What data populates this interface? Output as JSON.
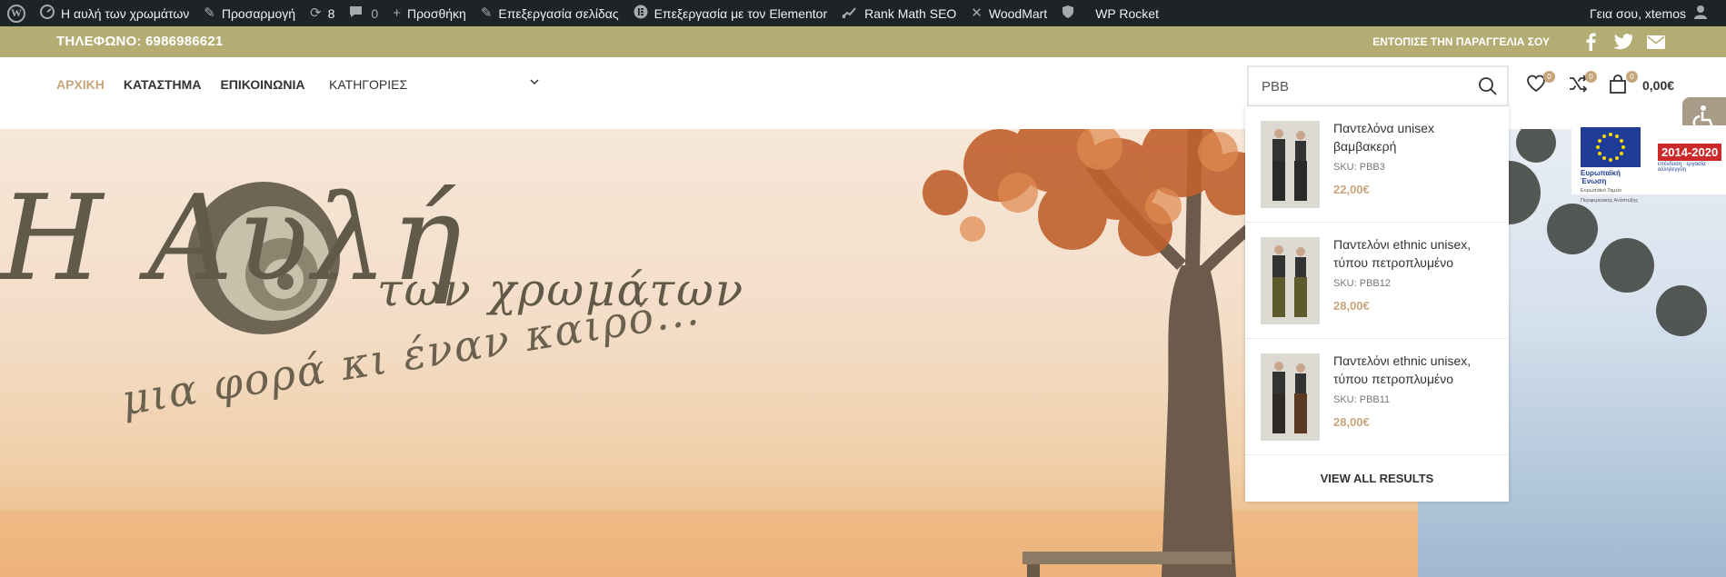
{
  "adminbar": {
    "site_name": "Η αυλή των χρωμάτων",
    "customize": "Προσαρμογή",
    "updates_count": "8",
    "comments_count": "0",
    "new": "Προσθήκη",
    "edit_page": "Επεξεργασία σελίδας",
    "edit_elementor": "Επεξεργασία με τον Elementor",
    "rank_math": "Rank Math SEO",
    "woodmart": "WoodMart",
    "wp_rocket": "WP Rocket",
    "greeting": "Γεια σου, xtemos"
  },
  "topbar": {
    "phone": "ΤΗΛΕΦΩΝΟ: 6986986621",
    "find_order": "ΕΝΤΟΠΙΣΕ ΤΗΝ ΠΑΡΑΓΓΕΛΙΑ ΣΟΥ"
  },
  "nav": {
    "items": [
      "ΑΡΧΙΚΗ",
      "ΚΑΤΑΣΤΗΜΑ",
      "ΕΠΙΚΟΙΝΩΝΙΑ"
    ],
    "categories": "ΚΑΤΗΓΟΡΙΕΣ"
  },
  "search": {
    "query": "PBB"
  },
  "header": {
    "wishlist_count": "0",
    "compare_count": "0",
    "cart_count": "0",
    "cart_total": "0,00€"
  },
  "hero": {
    "logo_line1": "Η Αυλή",
    "logo_line2": "των χρωμάτων",
    "logo_line3": "μια φορά κι έναν καιρό..."
  },
  "results": [
    {
      "title": "Παντελόνα unisex βαμβακερή",
      "sku": "SKU: PBB3",
      "price": "22,00€",
      "pants_color": "#2a2a2a"
    },
    {
      "title": "Παντελόνι ethnic unisex, τύπου πετροπλυμένο",
      "sku": "SKU: PBB12",
      "price": "28,00€",
      "pants_color": "#5e5a2c"
    },
    {
      "title": "Παντελόνι ethnic unisex, τύπου πετροπλυμένο",
      "sku": "SKU: PBB11",
      "price": "28,00€",
      "pants_color": "#2d2a28"
    }
  ],
  "view_all": "VIEW ALL RESULTS",
  "eu_badge": {
    "label": "Ευρωπαϊκή Ένωση",
    "sub": "Ευρωπαϊκό Ταμείο Περιφερειακής Ανάπτυξης",
    "years": "2014-2020",
    "tagline": "επένδυση · εργασία · αλληλεγγύη"
  },
  "colors": {
    "adminbar_bg": "#1d2327",
    "topbar_bg": "#b3ad73",
    "accent": "#c6a57b"
  }
}
